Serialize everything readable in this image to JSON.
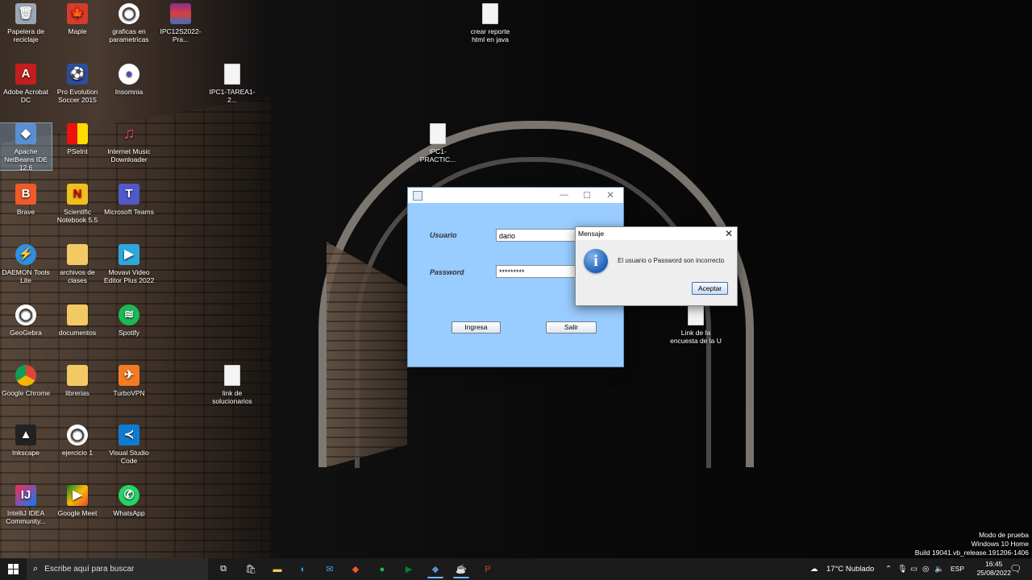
{
  "desktop_icons": [
    {
      "label": "Papelera de reciclaje",
      "icon": "recycle-bin-icon"
    },
    {
      "label": "Maple",
      "icon": "maple-icon"
    },
    {
      "label": "graficas en parametricas",
      "icon": "geogebra-icon"
    },
    {
      "label": "IPC12S2022-Pra...",
      "icon": "winrar-icon"
    },
    {
      "label": "crear reporte html en java",
      "icon": "file-icon"
    },
    {
      "label": "Adobe Acrobat DC",
      "icon": "acrobat-icon"
    },
    {
      "label": "Pro Evolution Soccer 2015",
      "icon": "pes-icon"
    },
    {
      "label": "Insomnia",
      "icon": "insomnia-icon"
    },
    {
      "label": "IPC1-TAREA1-2...",
      "icon": "file-icon"
    },
    {
      "label": "Apache NetBeans IDE 12.6",
      "icon": "netbeans-icon"
    },
    {
      "label": "PSeInt",
      "icon": "pseint-icon"
    },
    {
      "label": "Internet Music Downloader",
      "icon": "music-icon"
    },
    {
      "label": "IPC1-PRACTIC...",
      "icon": "file-icon"
    },
    {
      "label": "Brave",
      "icon": "brave-icon"
    },
    {
      "label": "Scientific Notebook 5.5",
      "icon": "scientific-notebook-icon"
    },
    {
      "label": "Microsoft Teams",
      "icon": "teams-icon"
    },
    {
      "label": "DAEMON Tools Lite",
      "icon": "daemon-tools-icon"
    },
    {
      "label": "archivos de clases",
      "icon": "folder-icon"
    },
    {
      "label": "Movavi Video Editor Plus 2022",
      "icon": "movavi-icon"
    },
    {
      "label": "GeoGebra",
      "icon": "geogebra-icon"
    },
    {
      "label": "documentos",
      "icon": "folder-icon"
    },
    {
      "label": "Spotify",
      "icon": "spotify-icon"
    },
    {
      "label": "Link de la encuesta de la U",
      "icon": "file-icon"
    },
    {
      "label": "Google Chrome",
      "icon": "chrome-icon"
    },
    {
      "label": "librerias",
      "icon": "folder-icon"
    },
    {
      "label": "TurboVPN",
      "icon": "turbovpn-icon"
    },
    {
      "label": "link de solucionarios",
      "icon": "file-icon"
    },
    {
      "label": "Inkscape",
      "icon": "inkscape-icon"
    },
    {
      "label": "ejercicio 1",
      "icon": "geogebra-icon"
    },
    {
      "label": "Visual Studio Code",
      "icon": "vscode-icon"
    },
    {
      "label": "IntelliJ IDEA Community...",
      "icon": "intellij-icon"
    },
    {
      "label": "Google Meet",
      "icon": "meet-icon"
    },
    {
      "label": "WhatsApp",
      "icon": "whatsapp-icon"
    }
  ],
  "login_window": {
    "usuario_label": "Usuario",
    "usuario_value": "dario",
    "password_label": "Password",
    "password_value": "*********",
    "ingresa_label": "Ingresa",
    "salir_label": "Salir"
  },
  "message_dialog": {
    "title": "Mensaje",
    "text": "El usuario o Password son incorrecto",
    "ok_label": "Aceptar"
  },
  "watermark": {
    "line1": "Modo de prueba",
    "line2": "Windows 10 Home",
    "line3": "Build 19041.vb_release.191206-1406"
  },
  "taskbar": {
    "search_placeholder": "Escribe aquí para buscar",
    "weather": "17°C  Nublado",
    "language": "ESP",
    "time": "16:45",
    "date": "25/08/2022"
  },
  "colors": {
    "app_bg": "#99ccff",
    "taskbar_bg": "#1b1b1b"
  }
}
